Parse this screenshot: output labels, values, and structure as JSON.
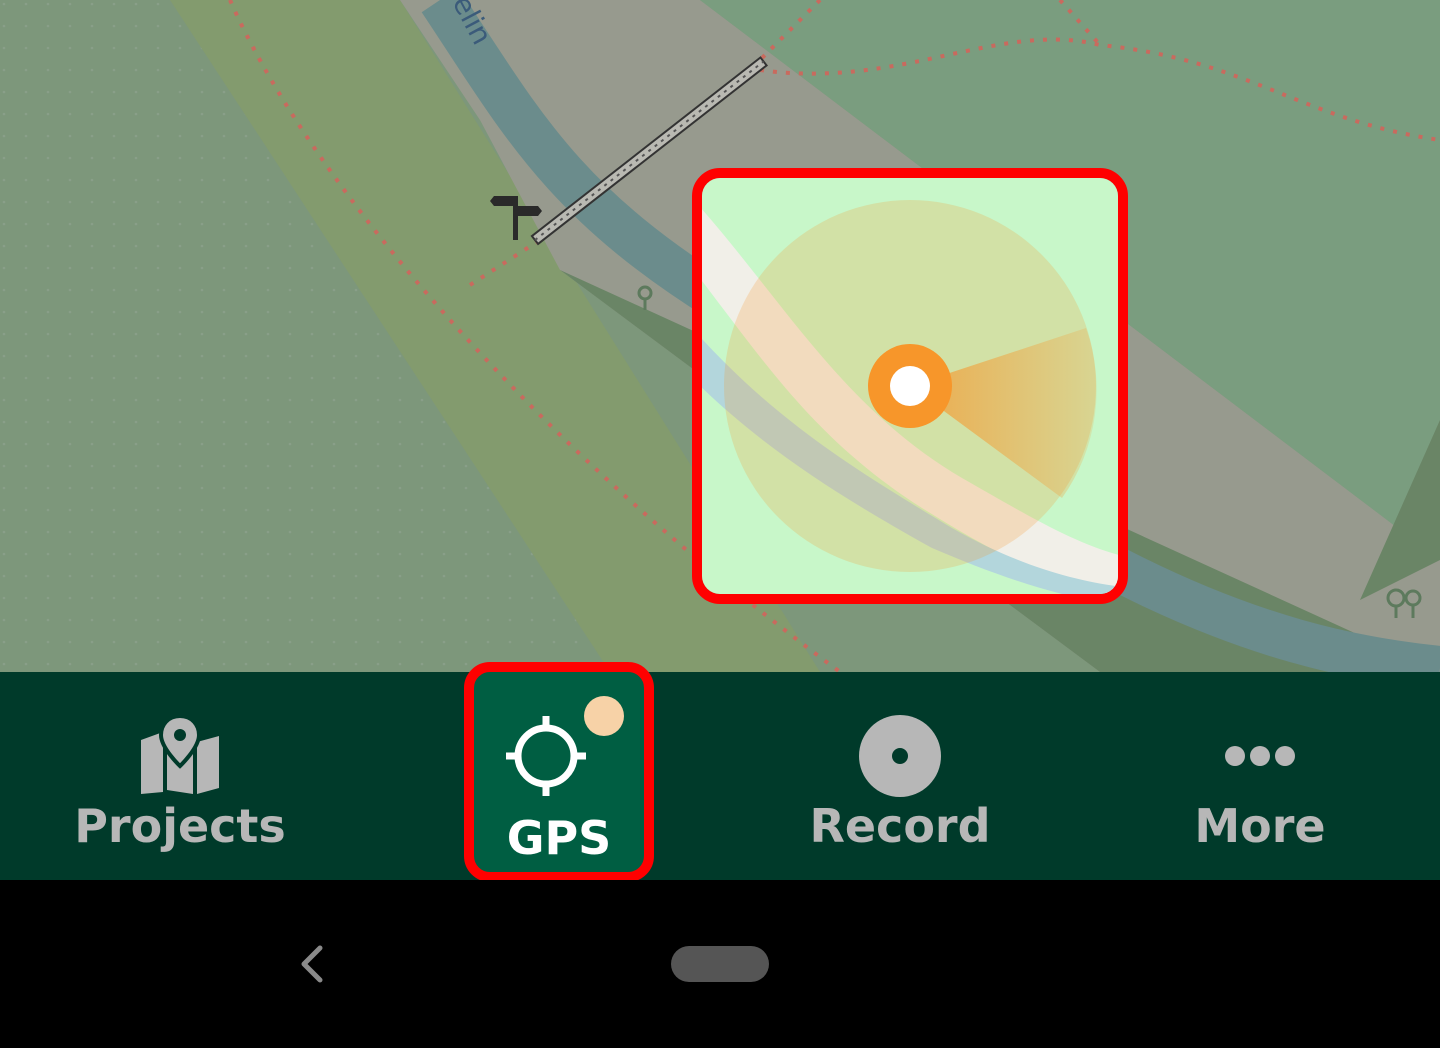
{
  "map": {
    "river_label": "elin"
  },
  "navbar": {
    "items": [
      {
        "label": "Projects",
        "icon": "map-pin-icon",
        "active": false
      },
      {
        "label": "GPS",
        "icon": "crosshair-icon",
        "active": true
      },
      {
        "label": "Record",
        "icon": "record-icon",
        "active": false
      },
      {
        "label": "More",
        "icon": "more-dots-icon",
        "active": false
      }
    ]
  },
  "colors": {
    "navbar_bg": "#003a2a",
    "active_tab_bg": "#005e42",
    "highlight_border": "#ff0000",
    "location_marker": "#f7962a",
    "gps_status_dot": "#f7d2a7"
  }
}
